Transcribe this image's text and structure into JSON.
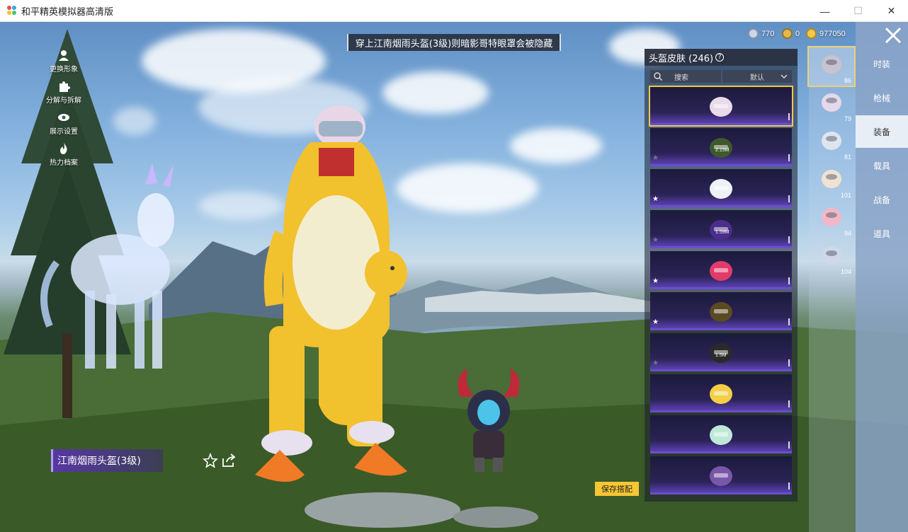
{
  "window": {
    "title": "和平精英模拟器高清版",
    "minimize": "—",
    "maximize": "☐",
    "close": "✕"
  },
  "notice": "穿上江南烟雨头盔(3级)则暗影哥特眼罩会被隐藏",
  "left_menu": [
    {
      "label": "更换形象",
      "icon": "avatar-icon"
    },
    {
      "label": "分解与拆解",
      "icon": "puzzle-icon"
    },
    {
      "label": "展示设置",
      "icon": "eye-icon"
    },
    {
      "label": "热力档案",
      "icon": "flame-icon"
    }
  ],
  "currency": [
    {
      "value": "770",
      "icon": "ticket-coin-icon",
      "color": "#cfd6e6"
    },
    {
      "value": "0",
      "icon": "a-coin-icon",
      "color": "#e6b84a"
    },
    {
      "value": "977050",
      "icon": "gold-coin-icon",
      "color": "#f2c94c"
    }
  ],
  "item_name": "江南烟雨头盔(3级)",
  "save_button": "保存搭配",
  "panel": {
    "title": "头盔皮肤 (246)",
    "help": "?",
    "search_placeholder": "搜索",
    "sort": "默认"
  },
  "skins": [
    {
      "name": "feather-helmet",
      "star": "none",
      "selected": true,
      "size": ""
    },
    {
      "name": "green-army-helmet",
      "star": "dim",
      "selected": false,
      "size": "2.15M"
    },
    {
      "name": "white-tech-helmet",
      "star": "bright",
      "selected": false,
      "size": ""
    },
    {
      "name": "purple-demon-helmet",
      "star": "dim",
      "selected": false,
      "size": "1.59M"
    },
    {
      "name": "pink-robot-helmet",
      "star": "bright",
      "selected": false,
      "size": ""
    },
    {
      "name": "dark-gold-helmet",
      "star": "bright",
      "selected": false,
      "size": ""
    },
    {
      "name": "black-download-helmet",
      "star": "dim",
      "selected": false,
      "size": "1.5M"
    },
    {
      "name": "chick-helmet",
      "star": "none",
      "selected": false,
      "size": ""
    },
    {
      "name": "mint-helmet",
      "star": "none",
      "selected": false,
      "size": ""
    },
    {
      "name": "purple-stripe-helmet",
      "star": "none",
      "selected": false,
      "size": ""
    }
  ],
  "equipped": [
    {
      "name": "helmet-slot",
      "count": "86",
      "selected": true
    },
    {
      "name": "backpack-slot",
      "count": "79",
      "selected": false
    },
    {
      "name": "helmet-alt-slot",
      "count": "81",
      "selected": false
    },
    {
      "name": "pendant-slot",
      "count": "101",
      "selected": false
    },
    {
      "name": "bow-slot",
      "count": "94",
      "selected": false
    },
    {
      "name": "ring-slot",
      "count": "104",
      "selected": false
    }
  ],
  "tabs": [
    {
      "label": "时装",
      "active": false
    },
    {
      "label": "枪械",
      "active": false
    },
    {
      "label": "装备",
      "active": true
    },
    {
      "label": "载具",
      "active": false
    },
    {
      "label": "战备",
      "active": false
    },
    {
      "label": "道具",
      "active": false
    }
  ]
}
